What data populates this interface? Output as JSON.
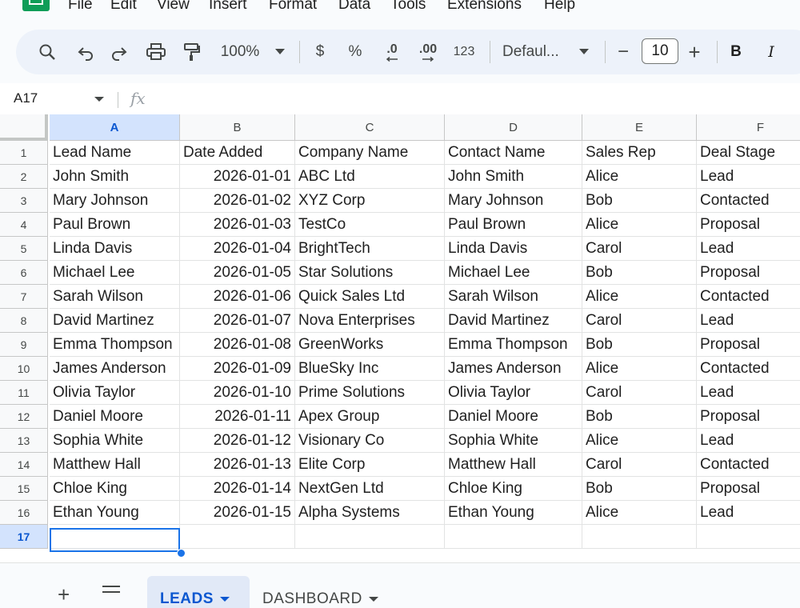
{
  "menu": [
    "File",
    "Edit",
    "View",
    "Insert",
    "Format",
    "Data",
    "Tools",
    "Extensions",
    "Help"
  ],
  "toolbar": {
    "zoom": "100%",
    "currency": "$",
    "percent": "%",
    "decrease_decimal": ".0",
    "increase_decimal": ".00",
    "number_format": "123",
    "font": "Defaul...",
    "font_size": "10",
    "minus": "−",
    "plus": "+",
    "bold": "B",
    "italic": "I"
  },
  "formula_bar": {
    "cell_ref": "A17",
    "fx": "fx"
  },
  "sheet": {
    "columns": [
      "A",
      "B",
      "C",
      "D",
      "E",
      "F"
    ],
    "rows": [
      [
        "Lead Name",
        "Date Added",
        "Company Name",
        "Contact Name",
        "Sales Rep",
        "Deal Stage"
      ],
      [
        "John Smith",
        "2026-01-01",
        "ABC Ltd",
        "John Smith",
        "Alice",
        "Lead"
      ],
      [
        "Mary Johnson",
        "2026-01-02",
        "XYZ Corp",
        "Mary Johnson",
        "Bob",
        "Contacted"
      ],
      [
        "Paul Brown",
        "2026-01-03",
        "TestCo",
        "Paul Brown",
        "Alice",
        "Proposal"
      ],
      [
        "Linda Davis",
        "2026-01-04",
        "BrightTech",
        "Linda Davis",
        "Carol",
        "Lead"
      ],
      [
        "Michael Lee",
        "2026-01-05",
        "Star Solutions",
        "Michael Lee",
        "Bob",
        "Proposal"
      ],
      [
        "Sarah Wilson",
        "2026-01-06",
        "Quick Sales Ltd",
        "Sarah Wilson",
        "Alice",
        "Contacted"
      ],
      [
        "David Martinez",
        "2026-01-07",
        "Nova Enterprises",
        "David Martinez",
        "Carol",
        "Lead"
      ],
      [
        "Emma Thompson",
        "2026-01-08",
        "GreenWorks",
        "Emma Thompson",
        "Bob",
        "Proposal"
      ],
      [
        "James Anderson",
        "2026-01-09",
        "BlueSky Inc",
        "James Anderson",
        "Alice",
        "Contacted"
      ],
      [
        "Olivia Taylor",
        "2026-01-10",
        "Prime Solutions",
        "Olivia Taylor",
        "Carol",
        "Lead"
      ],
      [
        "Daniel Moore",
        "2026-01-11",
        "Apex Group",
        "Daniel Moore",
        "Bob",
        "Proposal"
      ],
      [
        "Sophia White",
        "2026-01-12",
        "Visionary Co",
        "Sophia White",
        "Alice",
        "Lead"
      ],
      [
        "Matthew Hall",
        "2026-01-13",
        "Elite Corp",
        "Matthew Hall",
        "Carol",
        "Contacted"
      ],
      [
        "Chloe King",
        "2026-01-14",
        "NextGen Ltd",
        "Chloe King",
        "Bob",
        "Proposal"
      ],
      [
        "Ethan Young",
        "2026-01-15",
        "Alpha Systems",
        "Ethan Young",
        "Alice",
        "Lead"
      ],
      [
        "",
        "",
        "",
        "",
        "",
        ""
      ]
    ],
    "row_numbers": [
      "1",
      "2",
      "3",
      "4",
      "5",
      "6",
      "7",
      "8",
      "9",
      "10",
      "11",
      "12",
      "13",
      "14",
      "15",
      "16",
      "17"
    ],
    "selected_row": "17",
    "selected_col": "A"
  },
  "tabs": [
    {
      "label": "LEADS",
      "active": true
    },
    {
      "label": "DASHBOARD",
      "active": false
    }
  ],
  "colors": {
    "accent": "#0b57d0",
    "selection": "#1a73e8",
    "header_active": "#d3e3fd",
    "brand": "#0f9d58"
  }
}
